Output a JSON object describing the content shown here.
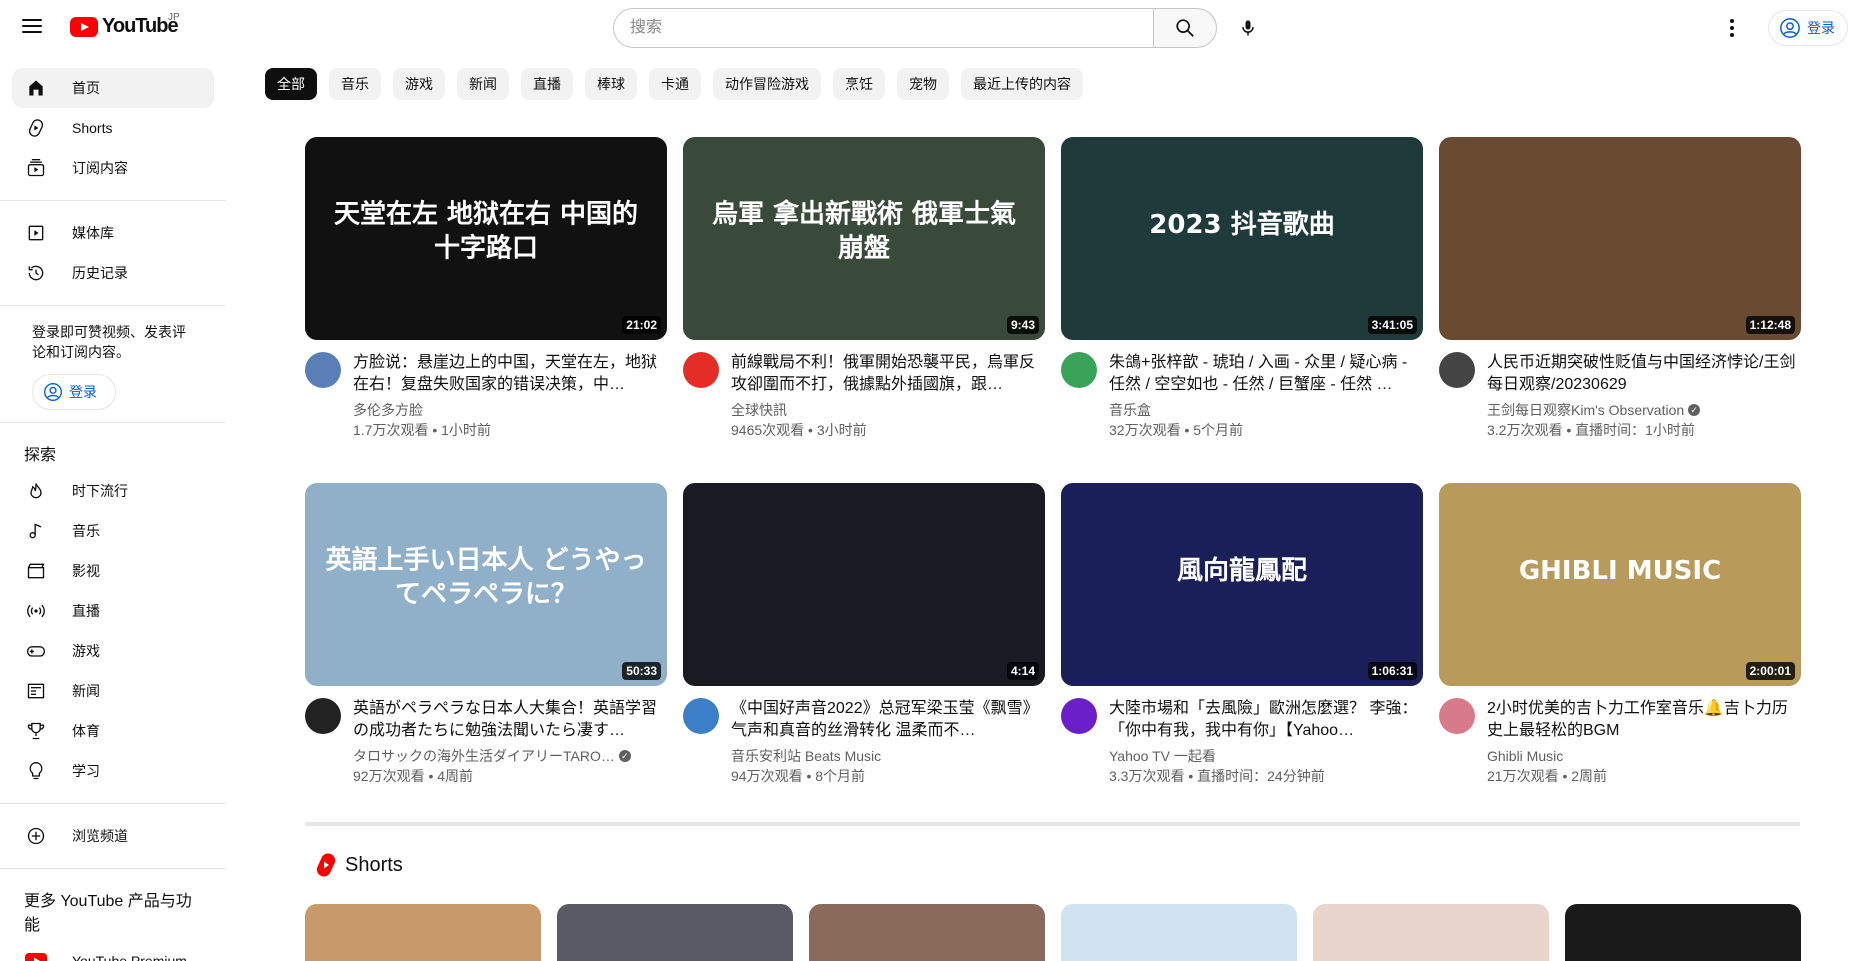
{
  "header": {
    "logo_text": "YouTube",
    "logo_region": "JP",
    "search_placeholder": "搜索",
    "signin_label": "登录"
  },
  "sidebar": {
    "items": [
      {
        "label": "首页",
        "icon": "home-icon",
        "active": true
      },
      {
        "label": "Shorts",
        "icon": "shorts-icon"
      },
      {
        "label": "订阅内容",
        "icon": "subscriptions-icon"
      }
    ],
    "items2": [
      {
        "label": "媒体库",
        "icon": "library-icon"
      },
      {
        "label": "历史记录",
        "icon": "history-icon"
      }
    ],
    "signin_note": "登录即可赞视频、发表评论和订阅内容。",
    "signin_label": "登录",
    "explore_heading": "探索",
    "explore": [
      {
        "label": "时下流行",
        "icon": "trending-icon"
      },
      {
        "label": "音乐",
        "icon": "music-icon"
      },
      {
        "label": "影视",
        "icon": "movies-icon"
      },
      {
        "label": "直播",
        "icon": "live-icon"
      },
      {
        "label": "游戏",
        "icon": "gaming-icon"
      },
      {
        "label": "新闻",
        "icon": "news-icon"
      },
      {
        "label": "体育",
        "icon": "sports-icon"
      },
      {
        "label": "学习",
        "icon": "learning-icon"
      }
    ],
    "browse_channels": "浏览频道",
    "more_heading": "更多 YouTube 产品与功能",
    "premium": "YouTube Premium"
  },
  "chips": [
    "全部",
    "音乐",
    "游戏",
    "新闻",
    "直播",
    "棒球",
    "卡通",
    "动作冒险游戏",
    "烹饪",
    "宠物",
    "最近上传的内容"
  ],
  "videos": [
    {
      "title": "方脸说：悬崖边上的中国，天堂在左，地狱在右！复盘失败国家的错误决策，中…",
      "channel": "多伦多方脸",
      "stats": "1.7万次观看 • 1小时前",
      "duration": "21:02",
      "thumb_text": "天堂在左 地狱在右 中国的十字路口",
      "thumb_color": "#111111",
      "avatar_color": "#5a7fb8",
      "verified": false
    },
    {
      "title": "前線戰局不利！俄軍開始恐襲平民，烏軍反攻卻圍而不打，俄據點外插國旗，跟…",
      "channel": "全球快訊",
      "stats": "9465次观看 • 3小时前",
      "duration": "9:43",
      "thumb_text": "烏軍 拿出新戰術 俄軍士氣 崩盤",
      "thumb_color": "#3a4a3a",
      "avatar_color": "#e52d27",
      "verified": false
    },
    {
      "title": "朱鴿+张梓歆 - 琥珀 / 入画 - 众里 / 疑心病 - 任然 / 空空如也 - 任然 / 巨蟹座 - 任然 …",
      "channel": "音乐盒",
      "stats": "32万次观看 • 5个月前",
      "duration": "3:41:05",
      "thumb_text": "2023 抖音歌曲",
      "thumb_color": "#1f3a3a",
      "avatar_color": "#3aa35a",
      "verified": false
    },
    {
      "title": "人民币近期突破性贬值与中国经济悖论/王剑每日观察/20230629",
      "channel": "王剑每日观察Kim's Observation",
      "stats": "3.2万次观看 • 直播时间：1小时前",
      "duration": "1:12:48",
      "thumb_text": "",
      "thumb_color": "#6b4a32",
      "avatar_color": "#444444",
      "verified": true
    },
    {
      "title": "英語がペラペラな日本人大集合！英語学習の成功者たちに勉強法聞いたら凄す…",
      "channel": "タロサックの海外生活ダイアリーTARO…",
      "stats": "92万次观看 • 4周前",
      "duration": "50:33",
      "thumb_text": "英語上手い日本人 どうやってペラペラに？",
      "thumb_color": "#8fb0c8",
      "avatar_color": "#222222",
      "verified": true
    },
    {
      "title": "《中国好声音2022》总冠军梁玉莹《飘雪》 气声和真音的丝滑转化 温柔而不…",
      "channel": "音乐安利站 Beats Music",
      "stats": "94万次观看 • 8个月前",
      "duration": "4:14",
      "thumb_text": "",
      "thumb_color": "#1a1a24",
      "avatar_color": "#3a7fc8",
      "verified": false
    },
    {
      "title": "大陸市場和「去風險」歐洲怎麼選？ 李強：「你中有我，我中有你」【Yahoo…",
      "channel": "Yahoo TV 一起看",
      "stats": "3.3万次观看 • 直播时间：24分钟前",
      "duration": "1:06:31",
      "thumb_text": "風向龍鳳配",
      "thumb_color": "#1a1f5a",
      "avatar_color": "#6a1fc8",
      "verified": false
    },
    {
      "title": "2小时优美的吉卜力工作室音乐🔔吉卜力历史上最轻松的BGM",
      "channel": "Ghibli Music",
      "stats": "21万次观看 • 2周前",
      "duration": "2:00:01",
      "thumb_text": "GHIBLI MUSIC",
      "thumb_color": "#b89a5a",
      "avatar_color": "#d87a8a",
      "verified": false
    }
  ],
  "shorts_heading": "Shorts",
  "shorts_colors": [
    "#c89a6a",
    "#5a5a66",
    "#8a6a5a",
    "#cfe3f2",
    "#e8d6cc",
    "#1a1a1a"
  ],
  "colors": {
    "brand_red": "#ff0000",
    "link_blue": "#065fd4",
    "chip_bg": "#f2f2f2",
    "text_secondary": "#606060"
  }
}
